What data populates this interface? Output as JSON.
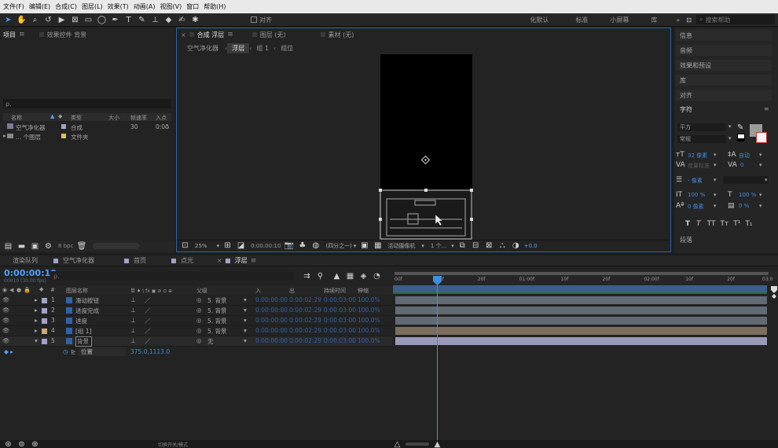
{
  "menu": [
    "文件(F)",
    "编辑(E)",
    "合成(C)",
    "图层(L)",
    "效果(T)",
    "动画(A)",
    "视图(V)",
    "窗口",
    "帮助(H)"
  ],
  "toolbar": {
    "align_label": "对齐",
    "workspaces": [
      " 化默认",
      "标准",
      "小屏幕",
      "库"
    ],
    "search_placeholder": "搜索帮助"
  },
  "project": {
    "tabs": [
      "项目",
      "效果控件 背景"
    ],
    "search_prefix": "ρ.",
    "columns": [
      "名称",
      "类型",
      "大小",
      "帧速率",
      "入点"
    ],
    "items": [
      {
        "name": "空气净化器",
        "type": "合成",
        "rate": "30",
        "inpoint": "0:00",
        "color": "#a3a3c8"
      },
      {
        "name": "... 个图层",
        "type": "文件夹",
        "rate": "",
        "inpoint": "",
        "color": "#d9c25e"
      }
    ],
    "bpc": "8 bpc"
  },
  "viewer": {
    "tabs": [
      {
        "label": "合成 浮层",
        "active": true
      },
      {
        "label": "图层 (无)",
        "active": false
      },
      {
        "label": "素材 (无)",
        "active": false
      }
    ],
    "breadcrumb": [
      "空气净化器",
      "浮层",
      "组 1",
      "组位"
    ],
    "footer": {
      "zoom": "25%",
      "timecode": "0:00:00:10",
      "resolution": "(四分之一)",
      "camera": "活动摄像机",
      "views": "1 个...",
      "exposure": "+0.0"
    }
  },
  "right_panel": {
    "items": [
      "信息",
      "音频",
      "效果和预设",
      "库",
      "对齐"
    ],
    "character_label": "字符",
    "font": "平方",
    "style": "常规",
    "size": "32 像素",
    "leading": "自动",
    "kerning": "度量标准",
    "tracking": "0",
    "indent": "- 像素",
    "vscale": "100 %",
    "hscale": "100 %",
    "baseline": "0 像素",
    "tsume": "0 %",
    "paragraph_label": "段落"
  },
  "timeline": {
    "tabs": [
      {
        "label": "渲染队列",
        "active": false,
        "color": ""
      },
      {
        "label": "空气净化器",
        "active": false,
        "color": "#a3a3c8"
      },
      {
        "label": "首页",
        "active": false,
        "color": "#a3a3c8"
      },
      {
        "label": "点光",
        "active": false,
        "color": "#a3a3c8"
      },
      {
        "label": "浮层",
        "active": true,
        "color": "#a3a3c8"
      }
    ],
    "timecode": "0:00:00:10",
    "fps_info": "00010 (30.00 fps)",
    "headers": {
      "name": "图层名称",
      "switches": "单 ♦ \\ fx ▣ ⊘ ⊙ ⊕",
      "parent": "父级",
      "in": "入",
      "out": "出",
      "duration": "持续时间",
      "stretch": "伸缩"
    },
    "ruler": [
      "00f",
      "10f",
      "20f",
      "01:00f",
      "10f",
      "20f",
      "02:00f",
      "10f",
      "20f",
      "03:0"
    ],
    "layers": [
      {
        "num": "1",
        "name": "滑动按钮",
        "parent": "5. 背景",
        "in": "0:00:00:00",
        "out": "0:00:02:29",
        "dur": "0:00:03:00",
        "stretch": "100.0%",
        "color": "#a3a3c8",
        "bar": "#626a74"
      },
      {
        "num": "2",
        "name": "进度完成",
        "parent": "5. 背景",
        "in": "0:00:00:00",
        "out": "0:00:02:29",
        "dur": "0:00:03:00",
        "stretch": "100.0%",
        "color": "#a3a3c8",
        "bar": "#626a74"
      },
      {
        "num": "3",
        "name": "进度",
        "parent": "5. 背景",
        "in": "0:00:00:00",
        "out": "0:00:02:29",
        "dur": "0:00:03:00",
        "stretch": "100.0%",
        "color": "#a3a3c8",
        "bar": "#626a74"
      },
      {
        "num": "4",
        "name": "[组 1]",
        "parent": "5. 背景",
        "in": "0:00:00:00",
        "out": "0:00:02:29",
        "dur": "0:00:03:00",
        "stretch": "100.0%",
        "color": "#c9a97a",
        "bar": "#7a6e5e"
      },
      {
        "num": "5",
        "name": "背景",
        "parent": "无",
        "in": "0:00:00:00",
        "out": "0:00:02:29",
        "dur": "0:00:03:00",
        "stretch": "100.0%",
        "color": "#a3a3c8",
        "bar": "#9a9ab8"
      }
    ],
    "property": {
      "name": "位置",
      "value": "375.0,1113.0"
    },
    "footer_label": "切换开关/模式"
  }
}
